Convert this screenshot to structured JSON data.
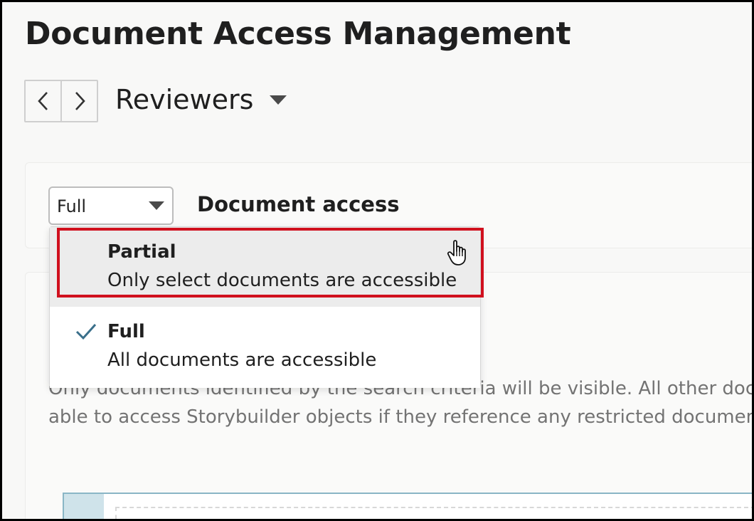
{
  "page": {
    "title": "Document Access Management"
  },
  "nav": {
    "prev_icon": "chevron-left-icon",
    "next_icon": "chevron-right-icon"
  },
  "view": {
    "title": "Reviewers",
    "caret_icon": "caret-down-icon"
  },
  "access": {
    "select_value": "Full",
    "section_label": "Document access"
  },
  "dropdown": {
    "options": [
      {
        "title": "Partial",
        "description": "Only select documents are accessible",
        "selected": false,
        "highlighted": true
      },
      {
        "title": "Full",
        "description": "All documents are accessible",
        "selected": true,
        "highlighted": false
      }
    ]
  },
  "description": {
    "line1": "Only documents identified by the search criteria will be visible. All other docu",
    "line2": "able to access Storybuilder objects if they reference any restricted documen"
  },
  "colors": {
    "highlight": "#d0101e",
    "check": "#3a6f8a",
    "panel_border": "#8ab6c6"
  }
}
